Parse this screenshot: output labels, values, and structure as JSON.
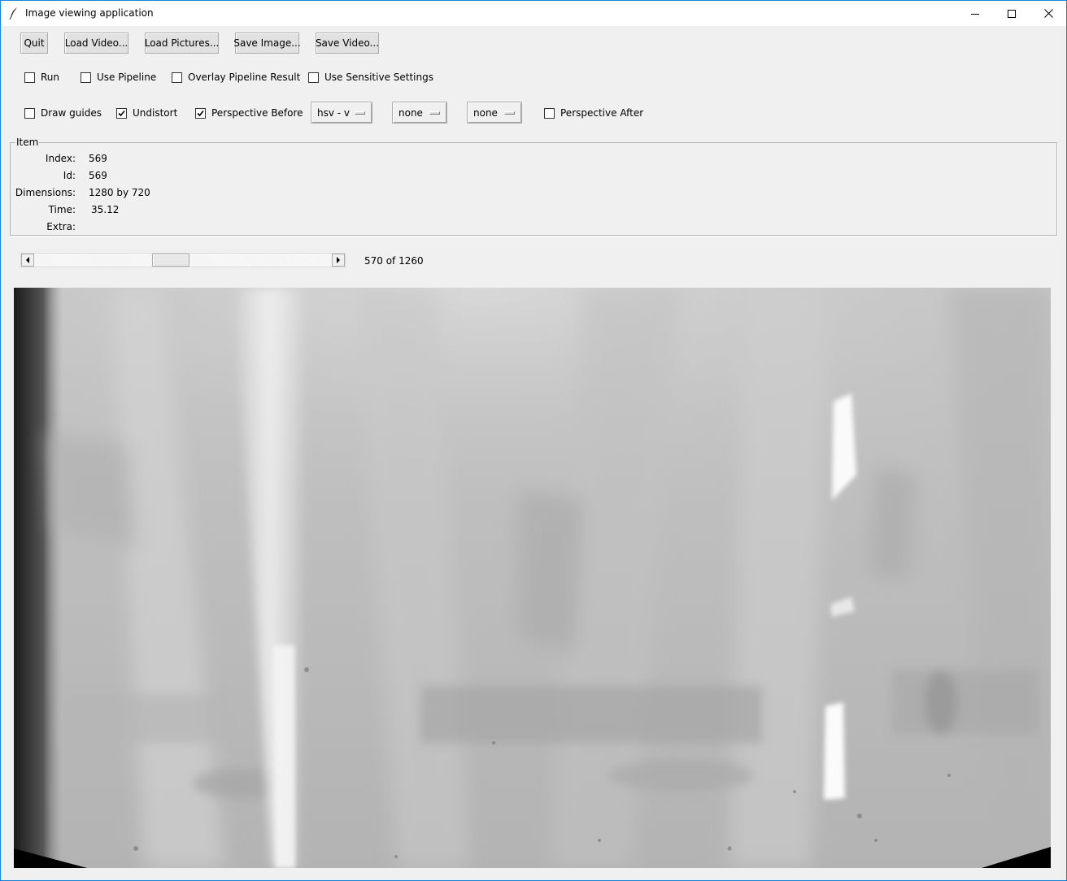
{
  "window": {
    "title": "Image viewing application"
  },
  "toolbar": {
    "quit": "Quit",
    "load_video": "Load Video...",
    "load_pictures": "Load Pictures...",
    "save_image": "Save Image...",
    "save_video": "Save Video..."
  },
  "options_row1": {
    "run": {
      "label": "Run",
      "checked": false
    },
    "use_pipeline": {
      "label": "Use Pipeline",
      "checked": false
    },
    "overlay": {
      "label": "Overlay Pipeline Result",
      "checked": false
    },
    "sensitive": {
      "label": "Use Sensitive Settings",
      "checked": false
    }
  },
  "options_row2": {
    "draw_guides": {
      "label": "Draw guides",
      "checked": false
    },
    "undistort": {
      "label": "Undistort",
      "checked": true
    },
    "perspective_before": {
      "label": "Perspective Before",
      "checked": true
    },
    "menu1": "hsv - v",
    "menu2": "none",
    "menu3": "none",
    "perspective_after": {
      "label": "Perspective After",
      "checked": false
    }
  },
  "item": {
    "legend": "Item",
    "index_label": "Index:",
    "index_value": "569",
    "id_label": "Id:",
    "id_value": "569",
    "dims_label": "Dimensions:",
    "dims_value": "1280 by 720",
    "time_label": "Time:",
    "time_value": "35.12",
    "extra_label": "Extra:",
    "extra_value": ""
  },
  "navigator": {
    "position_text": "570 of 1260",
    "position_fraction": 0.452
  },
  "colors": {
    "window_border": "#1883d7",
    "background": "#f0f0f0",
    "button_face": "#e1e1e1"
  }
}
